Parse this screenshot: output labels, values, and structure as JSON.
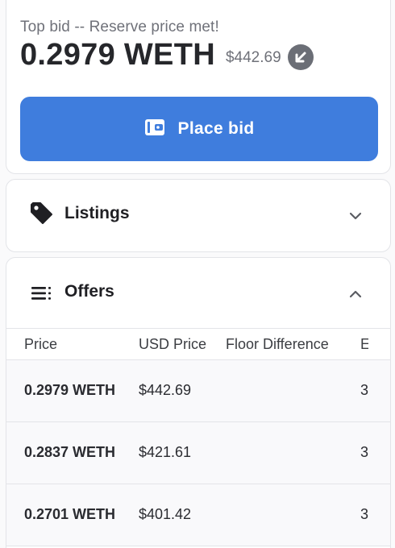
{
  "bid": {
    "status": "Top bid -- Reserve price met!",
    "price": "0.2979 WETH",
    "usd": "$442.69",
    "place_bid_label": "Place bid"
  },
  "listings": {
    "title": "Listings"
  },
  "offers": {
    "title": "Offers",
    "columns": [
      "Price",
      "USD Price",
      "Floor Difference",
      "E"
    ],
    "rows": [
      {
        "price": "0.2979 WETH",
        "usd": "$442.69",
        "floor": "",
        "expiration": "3"
      },
      {
        "price": "0.2837 WETH",
        "usd": "$421.61",
        "floor": "",
        "expiration": "3"
      },
      {
        "price": "0.2701 WETH",
        "usd": "$401.42",
        "floor": "",
        "expiration": "3"
      }
    ]
  },
  "colors": {
    "accent": "#3f7ddd",
    "muted": "#6f7179",
    "border": "#e3e4e8"
  },
  "icons": [
    "arrow-down-left-icon",
    "wallet-icon",
    "tag-icon",
    "chevron-down-icon",
    "list-icon",
    "chevron-up-icon"
  ]
}
